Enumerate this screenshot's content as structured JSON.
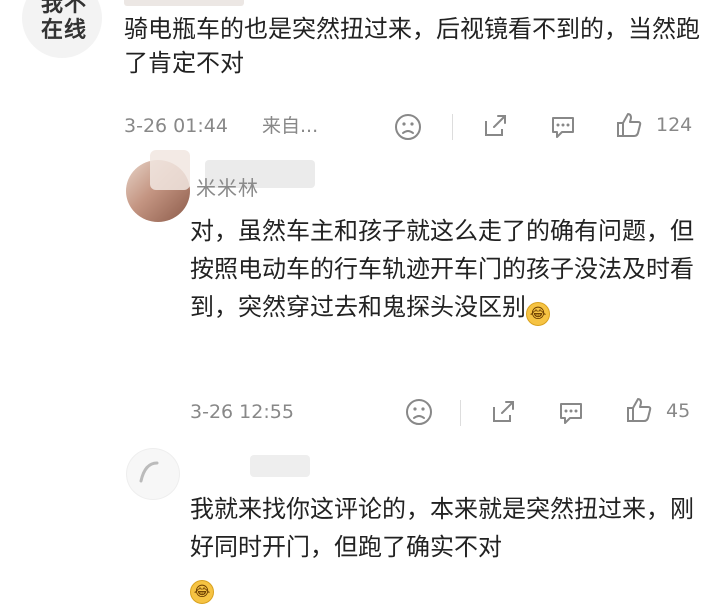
{
  "top_comment": {
    "avatar_text": "我不在线",
    "text": "骑电瓶车的也是突然扭过来，后视镜看不到的，当然跑了肯定不对",
    "time": "3-26 01:44",
    "source": "来自...",
    "like_count": "124"
  },
  "replies": [
    {
      "name": "米米林",
      "text": "对，虽然车主和孩子就这么走了的确有问题，但按照电动车的行车轨迹开车门的孩子没法及时看到，突然穿过去和鬼探头没区别",
      "time": "3-26 12:55",
      "like_count": "45"
    },
    {
      "name": "",
      "text": "我就来找你这评论的，本来就是突然扭过来，刚好同时开门，但跑了确实不对"
    }
  ],
  "icons": {
    "dislike": "sad-face-icon",
    "share": "share-icon",
    "comment": "comment-icon",
    "like": "thumbs-up-icon"
  },
  "colors": {
    "text": "#222222",
    "meta": "#888888",
    "background": "#ffffff"
  }
}
